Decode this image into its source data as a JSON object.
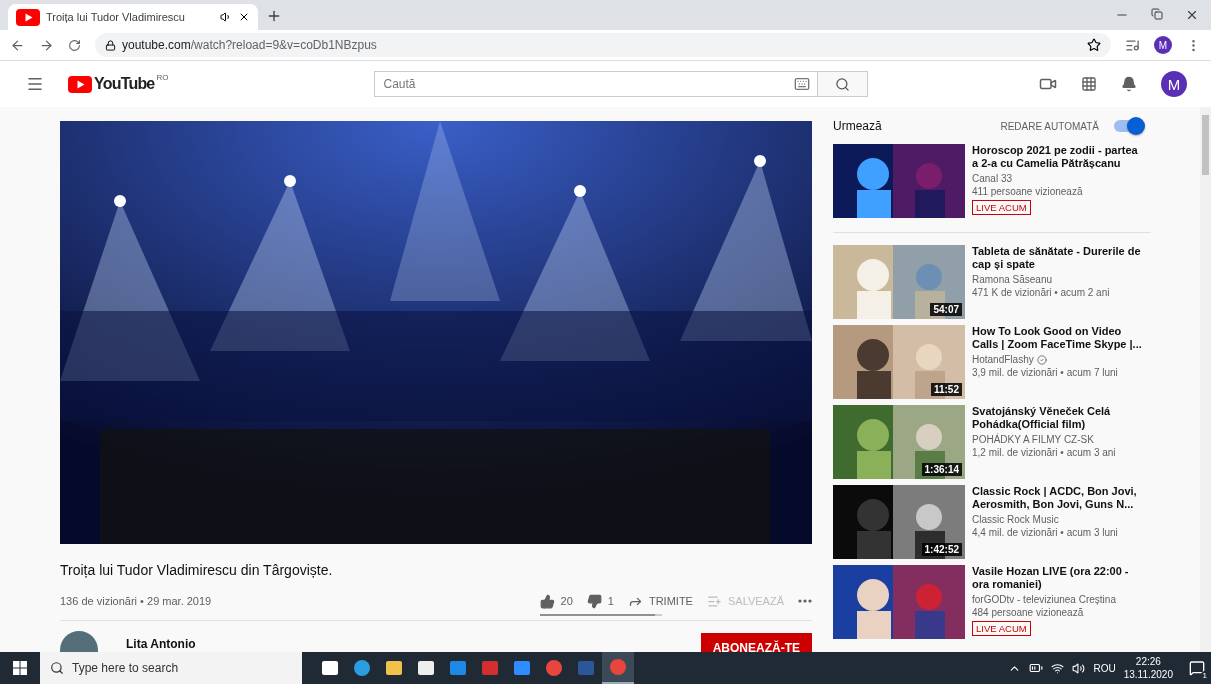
{
  "browser": {
    "tabs": [
      {
        "title": "Troița lui Tudor Vladimirescu",
        "selected": true,
        "playing_audio": true
      }
    ],
    "address": {
      "host": "youtube.com",
      "path": "/watch?reload=9&v=coDb1NBzpus"
    },
    "profile": "M"
  },
  "header": {
    "logo": "YouTube",
    "region": "RO",
    "search": {
      "placeholder": "Caută"
    },
    "avatar": "M"
  },
  "video": {
    "title": "Troița lui Tudor Vladimirescu din Târgoviște.",
    "meta": "136 de vizionări • 29 mar. 2019",
    "actions": [
      {
        "kind": "like",
        "label": "20",
        "disabled": false
      },
      {
        "kind": "dislike",
        "label": "1",
        "disabled": false
      },
      {
        "kind": "share",
        "label": "TRIMITE",
        "disabled": false
      },
      {
        "kind": "save",
        "label": "SALVEAZĂ",
        "disabled": true
      },
      {
        "kind": "more",
        "disabled": false
      }
    ],
    "like_ratio": {
      "level": 0.95
    },
    "channel": {
      "name": "Lita Antonio"
    },
    "subscribe": "ABONEAZĂ-TE"
  },
  "sidebar": {
    "heading": "Urmează",
    "autoplay": {
      "label": "REDARE AUTOMATĂ",
      "on": true
    },
    "items": [
      {
        "title": "Horoscop 2021 pe zodii - partea a 2-a cu Camelia Pătrășcanu",
        "channel": "Canal 33",
        "verified": false,
        "stats": "411 persoane vizionează",
        "badge": "LIVE ACUM"
      },
      {
        "title": "Tableta de sănătate - Durerile de cap și spate",
        "channel": "Ramona Săseanu",
        "verified": false,
        "stats": "471 K de vizionări • acum 2 ani",
        "duration": "54:07"
      },
      {
        "title": "How To Look Good on Video Calls | Zoom FaceTime Skype |...",
        "channel": "HotandFlashy",
        "verified": true,
        "stats": "3,9 mil. de vizionări • acum 7 luni",
        "duration": "11:52"
      },
      {
        "title": "Svatojánský Věneček Celá Pohádka(Official film)",
        "channel": "POHÁDKY A FILMY CZ-SK",
        "verified": false,
        "stats": "1,2 mil. de vizionări • acum 3 ani",
        "duration": "1:36:14"
      },
      {
        "title": "Classic Rock | ACDC, Bon Jovi, Aerosmith, Bon Jovi, Guns N...",
        "channel": "Classic Rock Music",
        "verified": false,
        "stats": "4,4 mil. de vizionări • acum 3 luni",
        "duration": "1:42:52"
      },
      {
        "title": "Vasile Hozan LIVE (ora 22:00 - ora romaniei)",
        "channel": "forGODtv - televiziunea Creștina",
        "verified": false,
        "stats": "484 persoane vizionează",
        "badge": "LIVE ACUM"
      }
    ]
  },
  "taskbar": {
    "search": {
      "placeholder": "Type here to search"
    },
    "apps": [
      {
        "kind": "taskview",
        "active": false
      },
      {
        "kind": "edge",
        "active": false
      },
      {
        "kind": "explorer",
        "active": false
      },
      {
        "kind": "store",
        "active": false
      },
      {
        "kind": "mail",
        "active": false
      },
      {
        "kind": "pdf",
        "active": false
      },
      {
        "kind": "zoom",
        "active": false
      },
      {
        "kind": "chrome",
        "active": false
      },
      {
        "kind": "word",
        "active": false
      },
      {
        "kind": "chrome-profile",
        "active": true
      }
    ],
    "language": "ROU",
    "time": "22:26",
    "date": "13.11.2020",
    "notifications": "1"
  }
}
